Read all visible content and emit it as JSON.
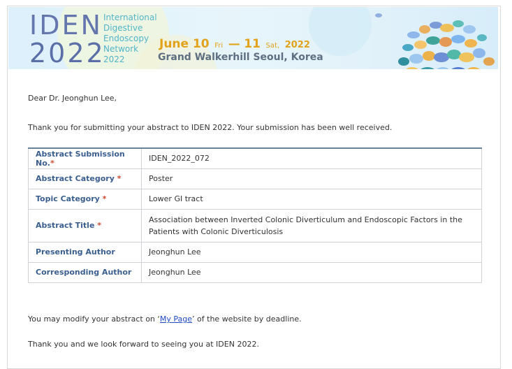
{
  "banner": {
    "logo_top": "IDEN",
    "logo_bottom": "2022",
    "org_lines": [
      "International",
      "Digestive",
      "Endoscopy",
      "Network",
      "2022"
    ],
    "date_start": "June 10",
    "date_start_day": "Fri",
    "date_dash": "—",
    "date_end": "11",
    "date_end_day": "Sat,",
    "date_year": "2022",
    "venue": "Grand Walkerhill Seoul, Korea"
  },
  "email": {
    "greeting": "Dear Dr. Jeonghun Lee,",
    "thanks": "Thank you for submitting your abstract to IDEN 2022. Your submission has been well received.",
    "modify_prefix": "You may modify your abstract on ‘",
    "modify_link": "My Page",
    "modify_suffix": "’ of the website by deadline.",
    "closing": "Thank you and we look forward to seeing you at IDEN 2022."
  },
  "table": {
    "rows": [
      {
        "label": "Abstract Submission No.",
        "required": "*",
        "value": "IDEN_2022_072"
      },
      {
        "label": "Abstract Category",
        "required": " *",
        "value": "Poster"
      },
      {
        "label": "Topic Category",
        "required": " *",
        "value": "Lower GI tract"
      },
      {
        "label": "Abstract Title",
        "required": " *",
        "value": "Association between Inverted Colonic Diverticulum and Endoscopic Factors in the Patients with Colonic Diverticulosis"
      },
      {
        "label": "Presenting Author",
        "required": "",
        "value": "Jeonghun Lee"
      },
      {
        "label": "Corresponding Author",
        "required": "",
        "value": "Jeonghun Lee"
      }
    ]
  },
  "colors": {
    "label_text": "#3a5f8f",
    "required_mark": "#d04a2d",
    "link": "#1f49c7",
    "date_accent": "#e2a21a",
    "venue_text": "#5e6f82",
    "org_text": "#52b4c9"
  }
}
